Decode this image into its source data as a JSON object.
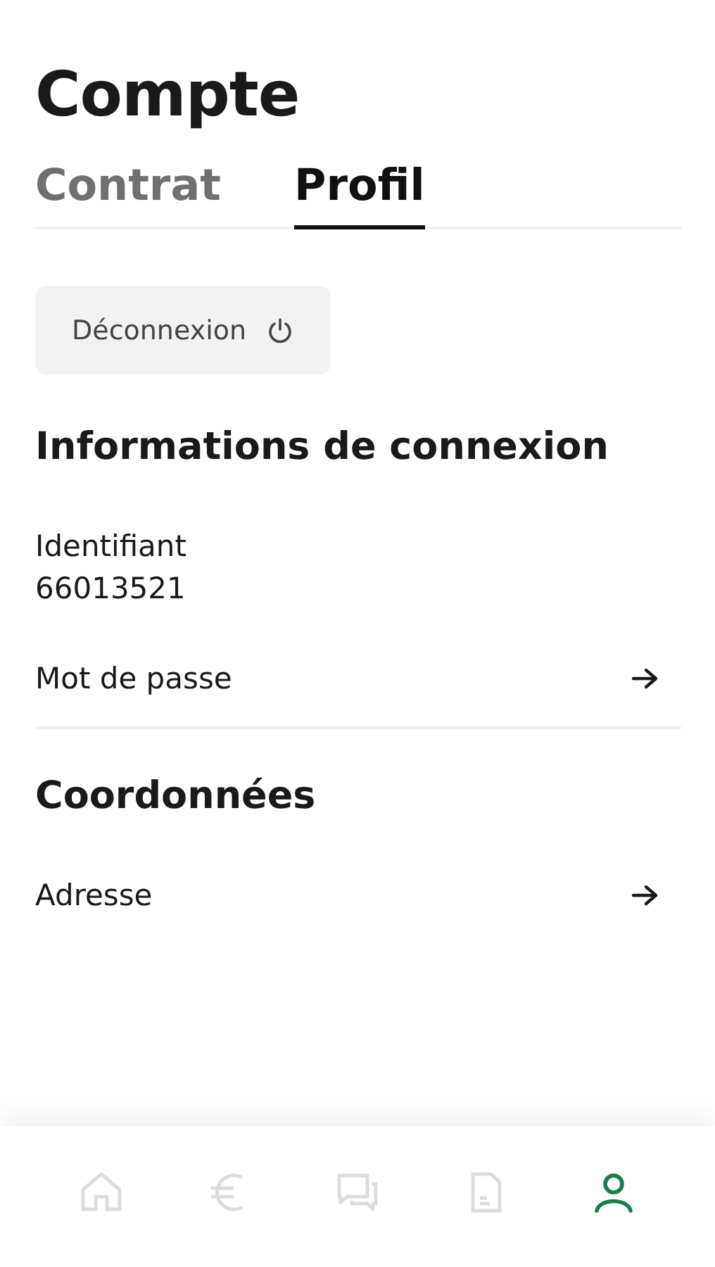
{
  "title": "Compte",
  "tabs": [
    {
      "label": "Contrat",
      "selected": false
    },
    {
      "label": "Profil",
      "selected": true
    }
  ],
  "logout_button": {
    "label": "Déconnexion"
  },
  "sections": [
    {
      "heading": "Informations de connexion",
      "items": [
        {
          "kind": "field",
          "label": "Identifiant",
          "value": "66013521"
        },
        {
          "kind": "link",
          "label": "Mot de passe"
        }
      ]
    },
    {
      "heading": "Coordonnées",
      "items": [
        {
          "kind": "link",
          "label": "Adresse"
        }
      ]
    }
  ],
  "bottom_nav": [
    {
      "kind": "home",
      "selected": false
    },
    {
      "kind": "euro",
      "selected": false
    },
    {
      "kind": "chat",
      "selected": false
    },
    {
      "kind": "document",
      "selected": false
    },
    {
      "kind": "user",
      "selected": true
    }
  ]
}
